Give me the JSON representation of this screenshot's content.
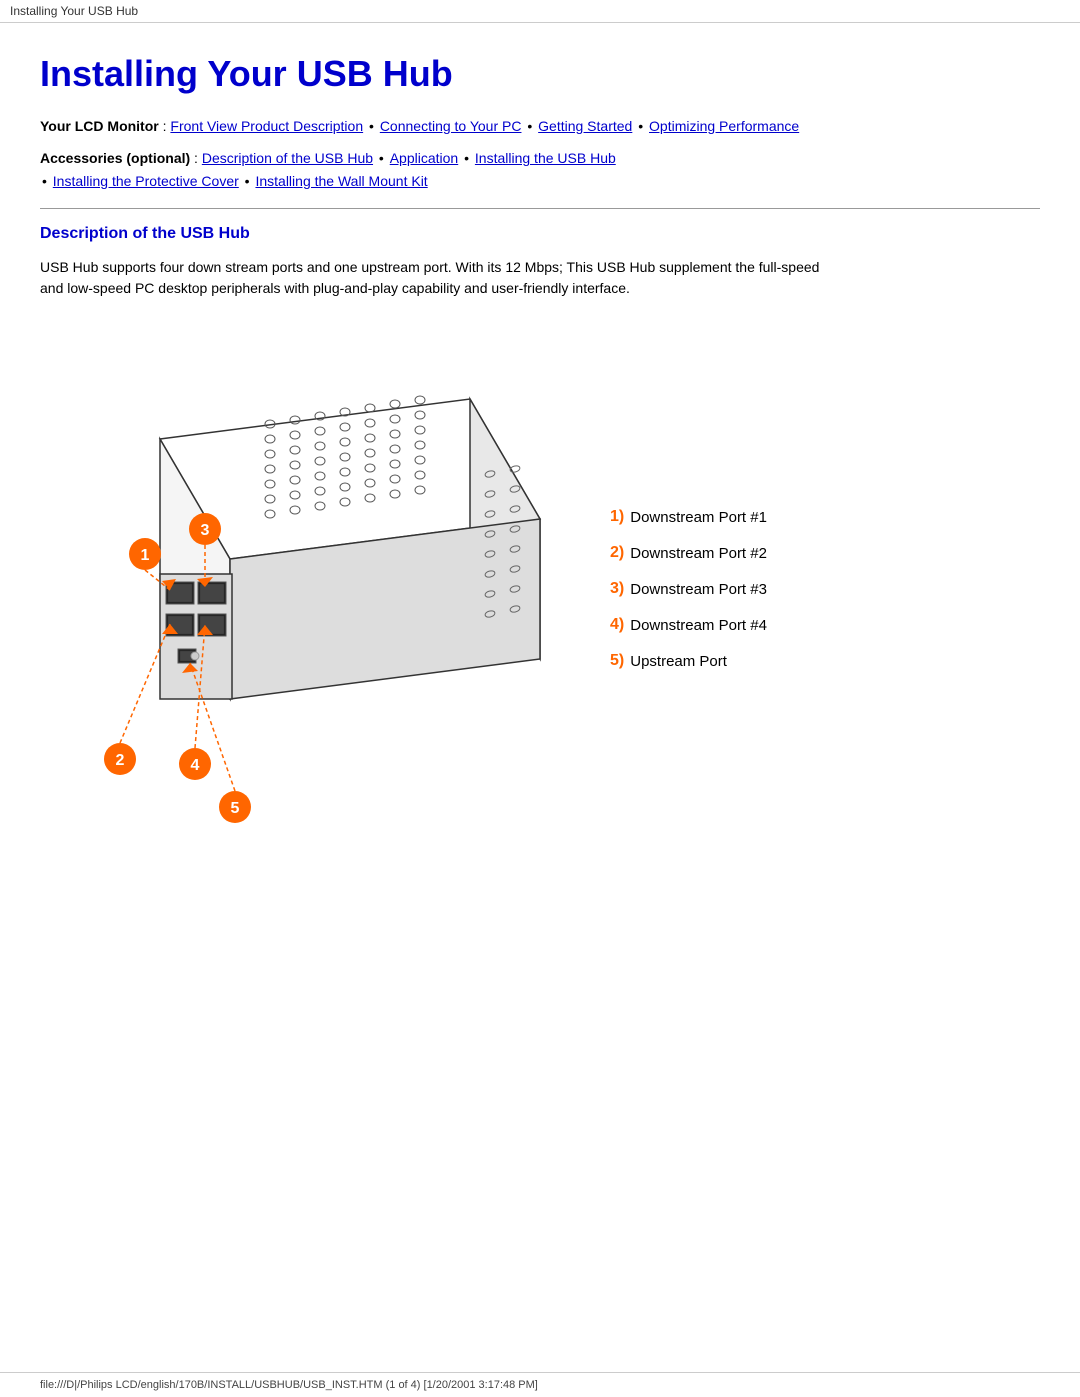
{
  "browser_tab": {
    "label": "Installing Your USB Hub"
  },
  "page": {
    "title": "Installing Your USB Hub"
  },
  "nav": {
    "your_lcd_label": "Your LCD Monitor",
    "colon": " : ",
    "lcd_links": [
      {
        "label": "Front View Product Description",
        "id": "link-front-view"
      },
      {
        "label": "Connecting to Your PC",
        "id": "link-connecting"
      },
      {
        "label": "Getting Started",
        "id": "link-getting-started"
      },
      {
        "label": "Optimizing Performance",
        "id": "link-optimizing"
      }
    ],
    "accessories_label": "Accessories (optional)",
    "acc_links": [
      {
        "label": "Description of the USB Hub",
        "id": "link-desc-usb"
      },
      {
        "label": "Application",
        "id": "link-application"
      },
      {
        "label": "Installing the USB Hub",
        "id": "link-installing-usb"
      },
      {
        "label": "Installing the Protective Cover",
        "id": "link-protective"
      },
      {
        "label": "Installing the Wall Mount Kit",
        "id": "link-wall-mount"
      }
    ]
  },
  "section": {
    "title": "Description of the USB Hub",
    "description": "USB Hub supports four down stream ports and one upstream port. With its 12 Mbps; This USB Hub supplement the full-speed and low-speed PC desktop peripherals with plug-and-play capability and user-friendly interface."
  },
  "legend": {
    "items": [
      {
        "num": "1)",
        "text": "Downstream Port #1"
      },
      {
        "num": "2)",
        "text": "Downstream Port #2"
      },
      {
        "num": "3)",
        "text": "Downstream Port #3"
      },
      {
        "num": "4)",
        "text": "Downstream Port #4"
      },
      {
        "num": "5)",
        "text": "Upstream Port"
      }
    ]
  },
  "footer": {
    "text": "file:///D|/Philips LCD/english/170B/INSTALL/USBHUB/USB_INST.HTM (1 of 4) [1/20/2001 3:17:48 PM]"
  }
}
